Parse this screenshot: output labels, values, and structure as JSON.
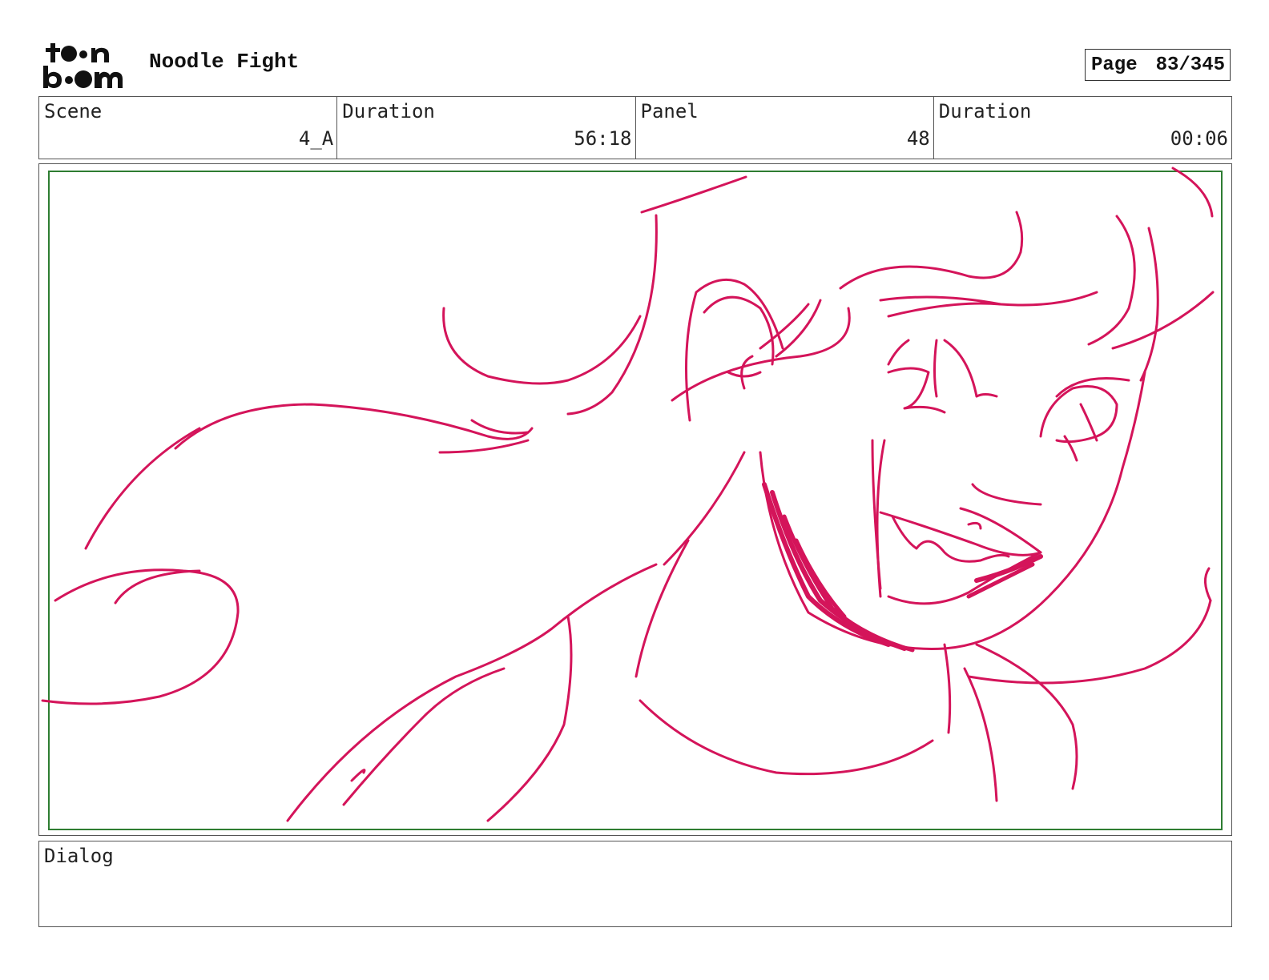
{
  "header": {
    "logo_alt": "toon boom",
    "project_title": "Noodle Fight",
    "page_label": "Page",
    "page_number": "83/345"
  },
  "info": {
    "scene_label": "Scene",
    "scene_value": "4_A",
    "scene_duration_label": "Duration",
    "scene_duration_value": "56:18",
    "panel_label": "Panel",
    "panel_value": "48",
    "panel_duration_label": "Duration",
    "panel_duration_value": "00:06"
  },
  "dialog": {
    "label": "Dialog",
    "text": ""
  },
  "colors": {
    "sketch": "#d4145a",
    "safe_frame": "#2e7d32"
  }
}
